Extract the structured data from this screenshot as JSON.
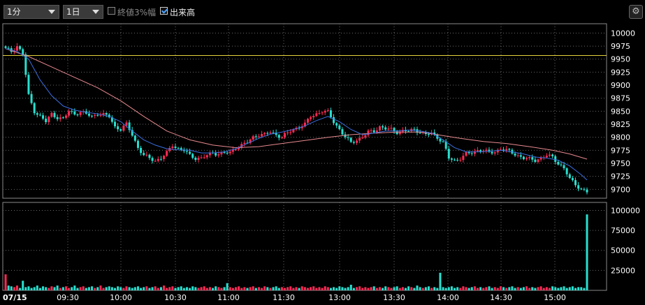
{
  "toolbar": {
    "interval_value": "1分",
    "period_value": "1日",
    "limit_label": "終値3%幅",
    "limit_checked": false,
    "volume_label": "出来高",
    "volume_checked": true,
    "settings_icon": "gear-icon"
  },
  "colors": {
    "up": "#ff2a55",
    "down": "#28e0d0",
    "ma_short": "#3a6fe0",
    "ma_long": "#e88a90",
    "ref_line": "#e6d23c",
    "grid": "#6a6a6a",
    "border": "#8a8a8a"
  },
  "chart_data": [
    {
      "type": "candlestick",
      "date_label": "07/15",
      "x_ticks": [
        "09:30",
        "10:00",
        "10:30",
        "11:00",
        "11:30",
        "13:00",
        "13:30",
        "14:00",
        "14:30",
        "15:00"
      ],
      "y_ticks": [
        10000,
        9975,
        9950,
        9925,
        9900,
        9875,
        9850,
        9825,
        9800,
        9775,
        9750,
        9725,
        9700
      ],
      "ylim": [
        9683,
        10018
      ],
      "reference_line": 9957,
      "price_path": [
        [
          0,
          9970
        ],
        [
          2,
          9965
        ],
        [
          4,
          9975
        ],
        [
          6,
          9960
        ],
        [
          8,
          9880
        ],
        [
          10,
          9850
        ],
        [
          12,
          9840
        ],
        [
          14,
          9830
        ],
        [
          16,
          9845
        ],
        [
          18,
          9838
        ],
        [
          20,
          9835
        ],
        [
          22,
          9850
        ],
        [
          24,
          9845
        ],
        [
          26,
          9848
        ],
        [
          28,
          9845
        ],
        [
          30,
          9840
        ],
        [
          32,
          9845
        ],
        [
          34,
          9843
        ],
        [
          36,
          9840
        ],
        [
          38,
          9820
        ],
        [
          40,
          9815
        ],
        [
          42,
          9825
        ],
        [
          44,
          9805
        ],
        [
          46,
          9780
        ],
        [
          48,
          9765
        ],
        [
          50,
          9760
        ],
        [
          52,
          9755
        ],
        [
          54,
          9760
        ],
        [
          56,
          9770
        ],
        [
          58,
          9785
        ],
        [
          60,
          9778
        ],
        [
          62,
          9775
        ],
        [
          64,
          9765
        ],
        [
          66,
          9760
        ],
        [
          68,
          9760
        ],
        [
          70,
          9765
        ],
        [
          72,
          9770
        ],
        [
          74,
          9768
        ],
        [
          76,
          9770
        ],
        [
          78,
          9770
        ],
        [
          80,
          9780
        ],
        [
          82,
          9785
        ],
        [
          84,
          9790
        ],
        [
          86,
          9800
        ],
        [
          88,
          9805
        ],
        [
          90,
          9805
        ],
        [
          92,
          9810
        ],
        [
          94,
          9805
        ],
        [
          96,
          9800
        ],
        [
          98,
          9808
        ],
        [
          100,
          9815
        ],
        [
          102,
          9820
        ],
        [
          104,
          9825
        ],
        [
          106,
          9840
        ],
        [
          108,
          9845
        ],
        [
          110,
          9850
        ],
        [
          112,
          9848
        ],
        [
          114,
          9830
        ],
        [
          116,
          9815
        ],
        [
          118,
          9800
        ],
        [
          120,
          9790
        ],
        [
          122,
          9795
        ],
        [
          124,
          9800
        ],
        [
          126,
          9810
        ],
        [
          128,
          9812
        ],
        [
          130,
          9820
        ],
        [
          132,
          9816
        ],
        [
          134,
          9815
        ],
        [
          136,
          9810
        ],
        [
          138,
          9812
        ],
        [
          140,
          9812
        ],
        [
          142,
          9815
        ],
        [
          144,
          9810
        ],
        [
          146,
          9805
        ],
        [
          148,
          9808
        ],
        [
          150,
          9800
        ],
        [
          152,
          9790
        ],
        [
          154,
          9760
        ],
        [
          156,
          9755
        ],
        [
          158,
          9760
        ],
        [
          160,
          9768
        ],
        [
          162,
          9770
        ],
        [
          164,
          9775
        ],
        [
          166,
          9775
        ],
        [
          168,
          9770
        ],
        [
          170,
          9772
        ],
        [
          172,
          9778
        ],
        [
          174,
          9775
        ],
        [
          176,
          9770
        ],
        [
          178,
          9765
        ],
        [
          180,
          9760
        ],
        [
          182,
          9758
        ],
        [
          184,
          9756
        ],
        [
          186,
          9760
        ],
        [
          188,
          9765
        ],
        [
          190,
          9762
        ],
        [
          192,
          9750
        ],
        [
          194,
          9740
        ],
        [
          196,
          9720
        ],
        [
          198,
          9710
        ],
        [
          200,
          9700
        ],
        [
          202,
          9695
        ]
      ],
      "ma_short": [
        [
          0,
          9970
        ],
        [
          4,
          9965
        ],
        [
          8,
          9950
        ],
        [
          12,
          9910
        ],
        [
          16,
          9880
        ],
        [
          20,
          9860
        ],
        [
          24,
          9852
        ],
        [
          28,
          9848
        ],
        [
          32,
          9845
        ],
        [
          36,
          9840
        ],
        [
          40,
          9830
        ],
        [
          44,
          9812
        ],
        [
          48,
          9795
        ],
        [
          52,
          9785
        ],
        [
          56,
          9778
        ],
        [
          60,
          9776
        ],
        [
          64,
          9775
        ],
        [
          68,
          9770
        ],
        [
          72,
          9770
        ],
        [
          76,
          9772
        ],
        [
          80,
          9778
        ],
        [
          84,
          9788
        ],
        [
          88,
          9798
        ],
        [
          92,
          9806
        ],
        [
          96,
          9810
        ],
        [
          100,
          9815
        ],
        [
          104,
          9822
        ],
        [
          108,
          9832
        ],
        [
          112,
          9840
        ],
        [
          116,
          9830
        ],
        [
          120,
          9815
        ],
        [
          124,
          9805
        ],
        [
          128,
          9808
        ],
        [
          132,
          9812
        ],
        [
          136,
          9812
        ],
        [
          140,
          9814
        ],
        [
          144,
          9812
        ],
        [
          148,
          9808
        ],
        [
          152,
          9795
        ],
        [
          156,
          9780
        ],
        [
          160,
          9772
        ],
        [
          164,
          9772
        ],
        [
          168,
          9773
        ],
        [
          172,
          9775
        ],
        [
          176,
          9772
        ],
        [
          180,
          9768
        ],
        [
          184,
          9762
        ],
        [
          188,
          9760
        ],
        [
          192,
          9756
        ],
        [
          196,
          9745
        ],
        [
          200,
          9728
        ],
        [
          202,
          9718
        ]
      ],
      "ma_long": [
        [
          0,
          9970
        ],
        [
          8,
          9955
        ],
        [
          16,
          9935
        ],
        [
          24,
          9915
        ],
        [
          32,
          9895
        ],
        [
          40,
          9870
        ],
        [
          48,
          9840
        ],
        [
          56,
          9812
        ],
        [
          64,
          9795
        ],
        [
          72,
          9785
        ],
        [
          80,
          9780
        ],
        [
          88,
          9782
        ],
        [
          96,
          9788
        ],
        [
          104,
          9794
        ],
        [
          112,
          9800
        ],
        [
          120,
          9805
        ],
        [
          128,
          9808
        ],
        [
          136,
          9810
        ],
        [
          144,
          9810
        ],
        [
          150,
          9805
        ],
        [
          158,
          9798
        ],
        [
          166,
          9792
        ],
        [
          174,
          9788
        ],
        [
          182,
          9782
        ],
        [
          190,
          9775
        ],
        [
          196,
          9768
        ],
        [
          202,
          9758
        ]
      ]
    },
    {
      "type": "bar",
      "name": "出来高",
      "y_ticks": [
        100000,
        75000,
        50000,
        25000
      ],
      "ylim": [
        0,
        110000
      ],
      "volume_values": [
        20000,
        6000,
        5000,
        4000,
        6000,
        3000,
        12000,
        4000,
        5000,
        3000,
        4000,
        6000,
        3000,
        5000,
        4000,
        3000,
        5000,
        4000,
        6000,
        3000,
        4000,
        5000,
        3000,
        4000,
        6000,
        3000,
        4000,
        5000,
        3000,
        4000,
        5000,
        3000,
        4000,
        6000,
        3000,
        4000,
        5000,
        4000,
        3000,
        5000,
        4000,
        3000,
        5000,
        4000,
        3000,
        4000,
        5000,
        3000,
        4000,
        5000,
        3000,
        4000,
        5000,
        3000,
        4000,
        6000,
        3000,
        4000,
        5000,
        3000,
        4000,
        5000,
        3000,
        4000,
        3000,
        5000,
        4000,
        3000,
        4000,
        5000,
        3000,
        4000,
        3000,
        5000,
        4000,
        3000,
        4000,
        9000,
        4000,
        3000,
        4000,
        5000,
        3000,
        4000,
        3000,
        4000,
        5000,
        3000,
        4000,
        3000,
        5000,
        4000,
        3000,
        4000,
        5000,
        3000,
        4000,
        3000,
        4000,
        5000,
        3000,
        4000,
        3000,
        5000,
        4000,
        3000,
        4000,
        5000,
        3000,
        4000,
        3000,
        5000,
        4000,
        3000,
        4000,
        3000,
        5000,
        4000,
        3000,
        4000,
        7000,
        3000,
        4000,
        5000,
        3000,
        4000,
        3000,
        4000,
        5000,
        3000,
        4000,
        3000,
        5000,
        4000,
        3000,
        4000,
        5000,
        3000,
        4000,
        3000,
        5000,
        4000,
        3000,
        6000,
        4000,
        3000,
        4000,
        5000,
        3000,
        4000,
        3000,
        22000,
        4000,
        3000,
        4000,
        5000,
        3000,
        4000,
        3000,
        5000,
        4000,
        3000,
        4000,
        5000,
        3000,
        4000,
        3000,
        4000,
        5000,
        3000,
        4000,
        3000,
        5000,
        4000,
        3000,
        4000,
        5000,
        3000,
        4000,
        3000,
        4000,
        5000,
        3000,
        4000,
        3000,
        4000,
        5000,
        3000,
        4000,
        3000,
        5000,
        4000,
        3000,
        4000,
        5000,
        3000,
        4000,
        5000,
        3000,
        4000,
        4000,
        3000,
        95000
      ]
    }
  ]
}
